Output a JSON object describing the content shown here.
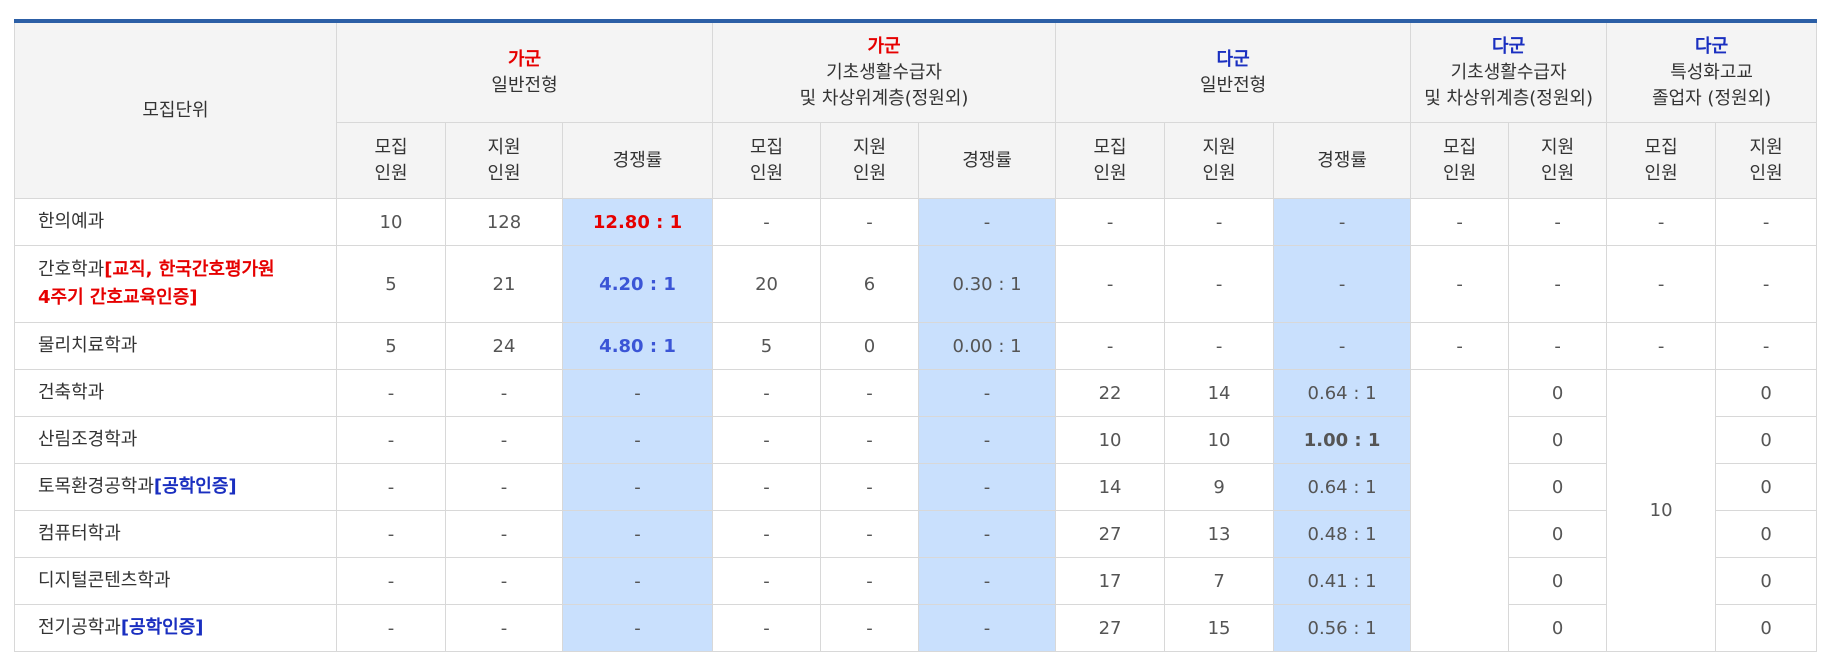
{
  "header": {
    "unit_label": "모집단위",
    "groups": [
      {
        "gun": "가군",
        "gun_color": "#e60000",
        "line1": "일반전형",
        "line2": ""
      },
      {
        "gun": "가군",
        "gun_color": "#e60000",
        "line1": "기초생활수급자",
        "line2": "및 차상위계층(정원외)"
      },
      {
        "gun": "다군",
        "gun_color": "#1a2fc0",
        "line1": "일반전형",
        "line2": ""
      },
      {
        "gun": "다군",
        "gun_color": "#1a2fc0",
        "line1": "기초생활수급자",
        "line2": "및 차상위계층(정원외)"
      },
      {
        "gun": "다군",
        "gun_color": "#1a2fc0",
        "line1": "특성화고교",
        "line2": "졸업자 (정원외)"
      }
    ],
    "col_recruit_1": "모집",
    "col_recruit_2": "인원",
    "col_apply_1": "지원",
    "col_apply_2": "인원",
    "col_rate": "경쟁률"
  },
  "rows": [
    {
      "name": "한의예과",
      "tag": "",
      "a_rec": "10",
      "a_app": "128",
      "a_rate": "12.80 : 1",
      "b_rec": "-",
      "b_app": "-",
      "b_rate": "-",
      "c_rec": "-",
      "c_app": "-",
      "c_rate": "-",
      "d_rec": "-",
      "d_app": "-",
      "e_rec": "-",
      "e_app": "-"
    },
    {
      "name": "간호학과",
      "tag": "[교직, 한국간호평가원",
      "tag2": "4주기 간호교육인증]",
      "a_rec": "5",
      "a_app": "21",
      "a_rate": "4.20 : 1",
      "b_rec": "20",
      "b_app": "6",
      "b_rate": "0.30 : 1",
      "c_rec": "-",
      "c_app": "-",
      "c_rate": "-",
      "d_rec": "-",
      "d_app": "-",
      "e_rec": "-",
      "e_app": "-"
    },
    {
      "name": "물리치료학과",
      "tag": "",
      "a_rec": "5",
      "a_app": "24",
      "a_rate": "4.80 : 1",
      "b_rec": "5",
      "b_app": "0",
      "b_rate": "0.00 : 1",
      "c_rec": "-",
      "c_app": "-",
      "c_rate": "-",
      "d_rec": "-",
      "d_app": "-",
      "e_rec": "-",
      "e_app": "-"
    },
    {
      "name": "건축학과",
      "tag": "",
      "a_rec": "-",
      "a_app": "-",
      "a_rate": "-",
      "b_rec": "-",
      "b_app": "-",
      "b_rate": "-",
      "c_rec": "22",
      "c_app": "14",
      "c_rate": "0.64 : 1",
      "d_app": "0",
      "e_app": "0"
    },
    {
      "name": "산림조경학과",
      "tag": "",
      "a_rec": "-",
      "a_app": "-",
      "a_rate": "-",
      "b_rec": "-",
      "b_app": "-",
      "b_rate": "-",
      "c_rec": "10",
      "c_app": "10",
      "c_rate": "1.00 : 1",
      "d_app": "0",
      "e_app": "0"
    },
    {
      "name": "토목환경공학과",
      "tag": "[공학인증]",
      "a_rec": "-",
      "a_app": "-",
      "a_rate": "-",
      "b_rec": "-",
      "b_app": "-",
      "b_rate": "-",
      "c_rec": "14",
      "c_app": "9",
      "c_rate": "0.64 : 1",
      "d_app": "0",
      "e_app": "0"
    },
    {
      "name": "컴퓨터학과",
      "tag": "",
      "a_rec": "-",
      "a_app": "-",
      "a_rate": "-",
      "b_rec": "-",
      "b_app": "-",
      "b_rate": "-",
      "c_rec": "27",
      "c_app": "13",
      "c_rate": "0.48 : 1",
      "d_app": "0",
      "e_app": "0"
    },
    {
      "name": "디지털콘텐츠학과",
      "tag": "",
      "a_rec": "-",
      "a_app": "-",
      "a_rate": "-",
      "b_rec": "-",
      "b_app": "-",
      "b_rate": "-",
      "c_rec": "17",
      "c_app": "7",
      "c_rate": "0.41 : 1",
      "d_app": "0",
      "e_app": "0"
    },
    {
      "name": "전기공학과",
      "tag": "[공학인증]",
      "a_rec": "-",
      "a_app": "-",
      "a_rate": "-",
      "b_rec": "-",
      "b_app": "-",
      "b_rate": "-",
      "c_rec": "27",
      "c_app": "15",
      "c_rate": "0.56 : 1",
      "d_app": "0",
      "e_app": "0"
    }
  ],
  "merged": {
    "e_rec": "10"
  }
}
